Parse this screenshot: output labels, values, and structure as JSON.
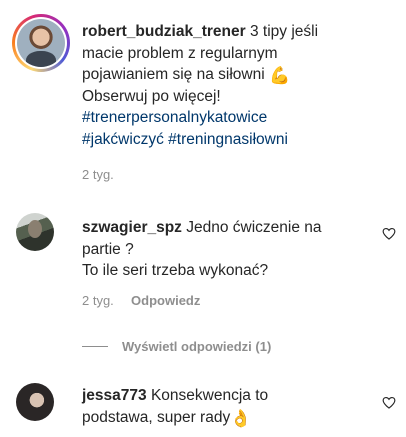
{
  "post_caption": {
    "username": "robert_budziak_trener",
    "line1_text": " 3 tipy jeśli",
    "line2": "macie problem z regularnym",
    "line3": "pojawianiem się na siłowni ",
    "flex_emoji": "💪",
    "line4": "Obserwuj po więcej!",
    "hashtag1": "#trenerpersonalnykatowice",
    "hashtag2": "#jakćwiczyć",
    "hashtag3": "#treningnasiłowni",
    "timestamp": "2 tyg."
  },
  "comment1": {
    "username": "szwagier_spz",
    "line1_text": " Jedno ćwiczenie na",
    "line2": "partie ?",
    "line3": "To ile seri trzeba wykonać?",
    "timestamp": "2 tyg.",
    "reply_label": "Odpowiedz",
    "view_replies_label": "Wyświetl odpowiedzi (1)"
  },
  "comment2": {
    "username": "jessa773",
    "line1_text": " Konsekwencja to",
    "line2": "podstawa, super rady",
    "ok_emoji": "👌"
  },
  "colors": {
    "hashtag": "#00376b",
    "meta": "#8e8e8e",
    "text": "#262626"
  }
}
